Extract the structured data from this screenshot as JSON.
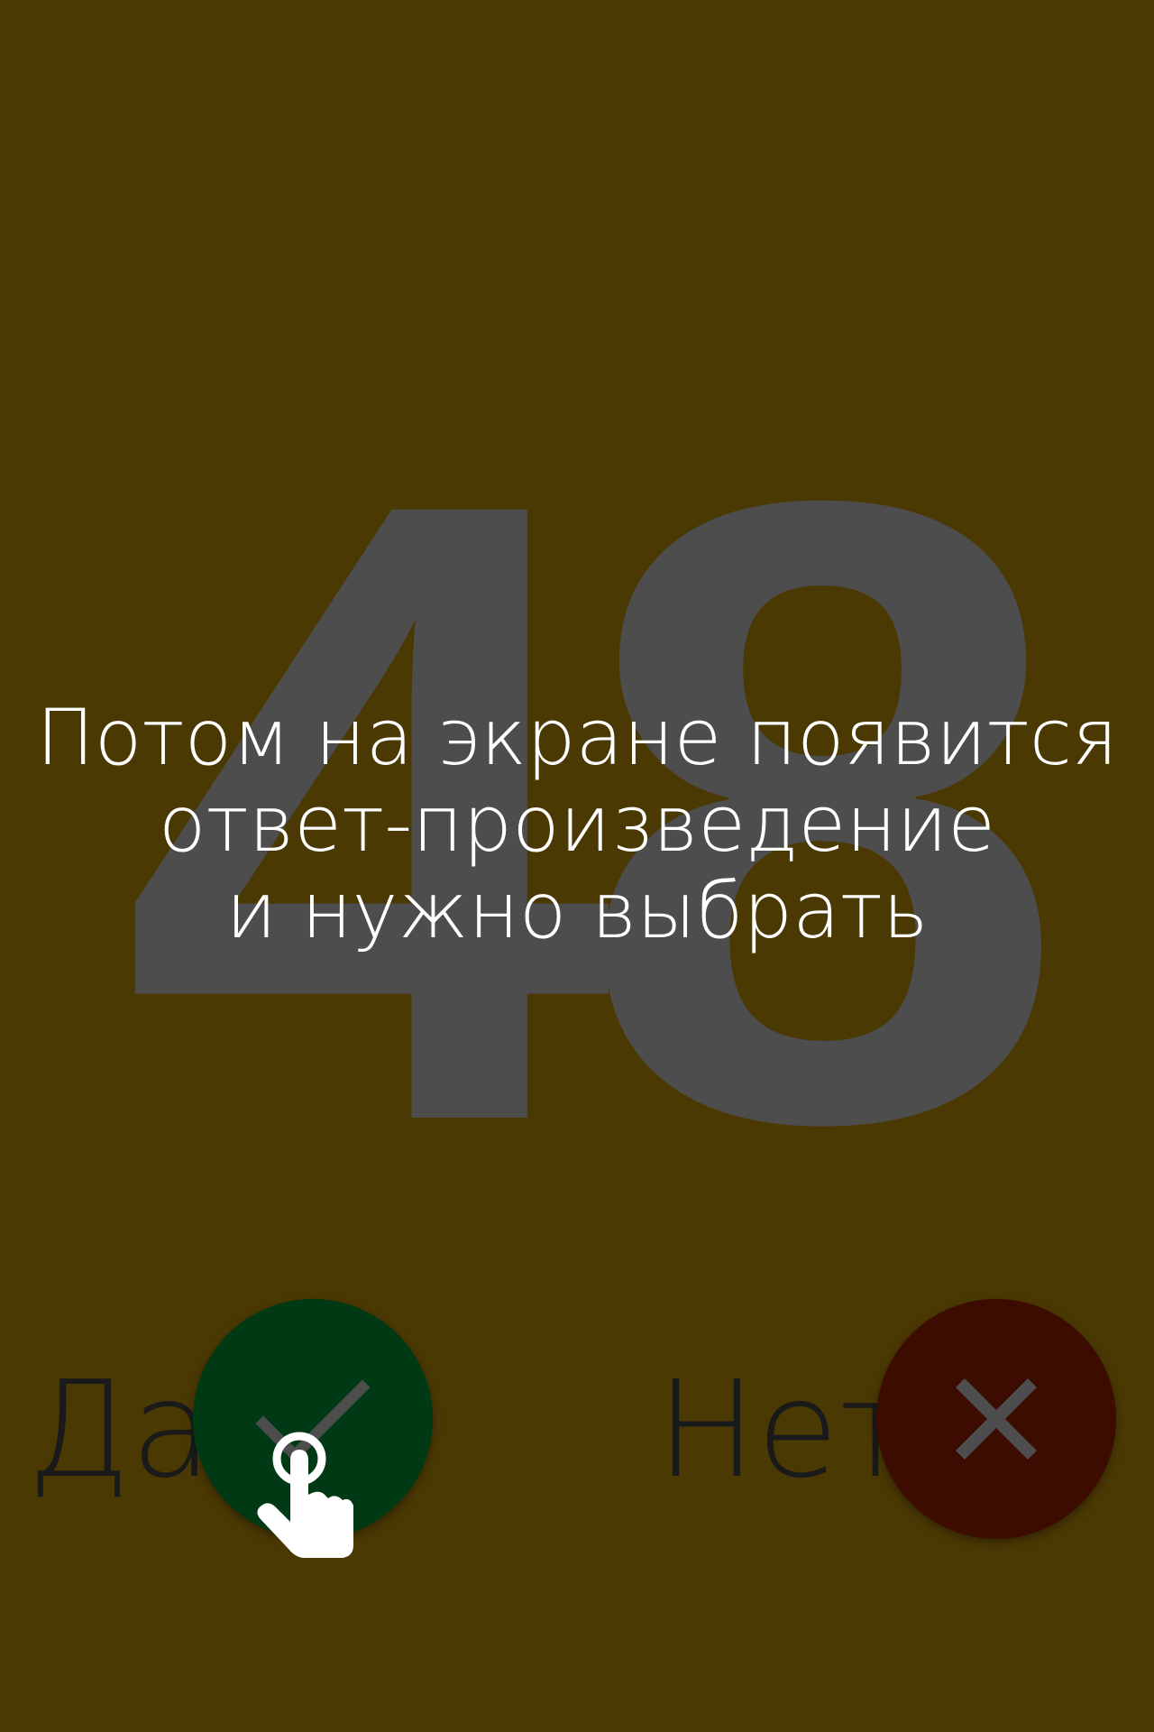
{
  "colors": {
    "background": "#4b3904",
    "big_number": "#4d4d4d",
    "yes_button": "#003a14",
    "no_button": "#3d0c00",
    "icon": "#4d4d4d",
    "text": "#ffffff",
    "labels": "#1a1a1a"
  },
  "main": {
    "big_number": "48",
    "instruction_lines": [
      "Потом на экране появится",
      "ответ-произведение",
      "и нужно выбрать"
    ]
  },
  "answers": {
    "yes_label": "Да",
    "yes_icon": "check-icon",
    "no_label": "Нет",
    "no_icon": "close-icon"
  },
  "hint": {
    "icon": "tap-hand-icon"
  }
}
